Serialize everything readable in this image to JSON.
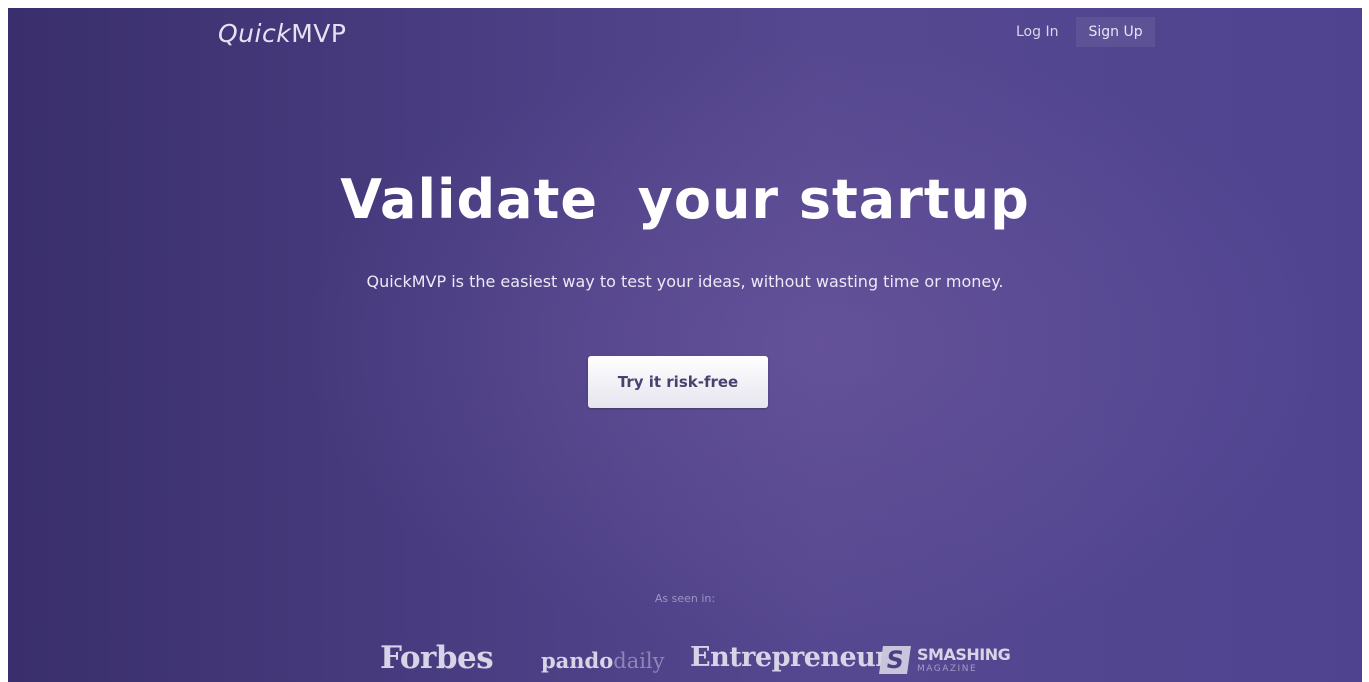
{
  "header": {
    "logo_part1": "Quick",
    "logo_part2": "MVP",
    "login_label": "Log In",
    "signup_label": "Sign Up"
  },
  "hero": {
    "title": "Validate  your startup",
    "subtitle": "QuickMVP is the easiest way to test your ideas, without wasting time or money.",
    "cta_label": "Try it risk-free"
  },
  "press": {
    "label": "As seen in:",
    "forbes": "Forbes",
    "pando_main": "pando",
    "pando_suffix": "daily",
    "entrepreneur": "Entrepreneur",
    "smashing_badge": "S",
    "smashing_main": "SMASHING",
    "smashing_sub": "MAGAZINE"
  },
  "colors": {
    "background_start": "#3a2f6c",
    "background_end": "#4f4390",
    "cta_text": "#4a416f"
  }
}
